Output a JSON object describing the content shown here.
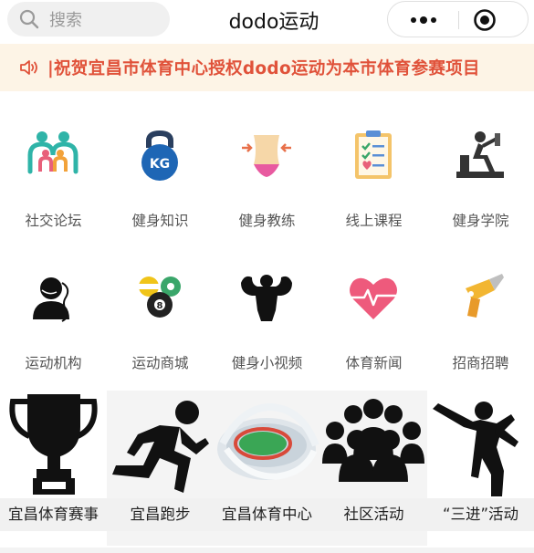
{
  "header": {
    "search_label": "搜索",
    "title": "dodo运动"
  },
  "notice": {
    "text": "|祝贺宜昌市体育中心授权dodo运动为本市体育参赛项目"
  },
  "row1": [
    {
      "label": "社交论坛",
      "icon": "people-icon"
    },
    {
      "label": "健身知识",
      "icon": "kettlebell-icon"
    },
    {
      "label": "健身教练",
      "icon": "waist-icon"
    },
    {
      "label": "线上课程",
      "icon": "checklist-icon"
    },
    {
      "label": "健身学院",
      "icon": "rowing-machine-icon"
    }
  ],
  "row2": [
    {
      "label": "运动机构",
      "icon": "agent-icon"
    },
    {
      "label": "运动商城",
      "icon": "billiard-balls-icon"
    },
    {
      "label": "健身小视频",
      "icon": "muscle-icon"
    },
    {
      "label": "体育新闻",
      "icon": "heart-pulse-icon"
    },
    {
      "label": "招商招聘",
      "icon": "drill-icon"
    }
  ],
  "row3": [
    {
      "label": "宜昌体育赛事",
      "icon": "trophy-icon"
    },
    {
      "label": "宜昌跑步",
      "icon": "runner-icon"
    },
    {
      "label": "宜昌体育中心",
      "icon": "stadium-icon"
    },
    {
      "label": "社区活动",
      "icon": "crowd-icon"
    },
    {
      "label": "“三进”活动",
      "icon": "kick-icon"
    }
  ],
  "colors": {
    "notice_bg": "#fdf4e6",
    "notice_text": "#e0523a"
  }
}
